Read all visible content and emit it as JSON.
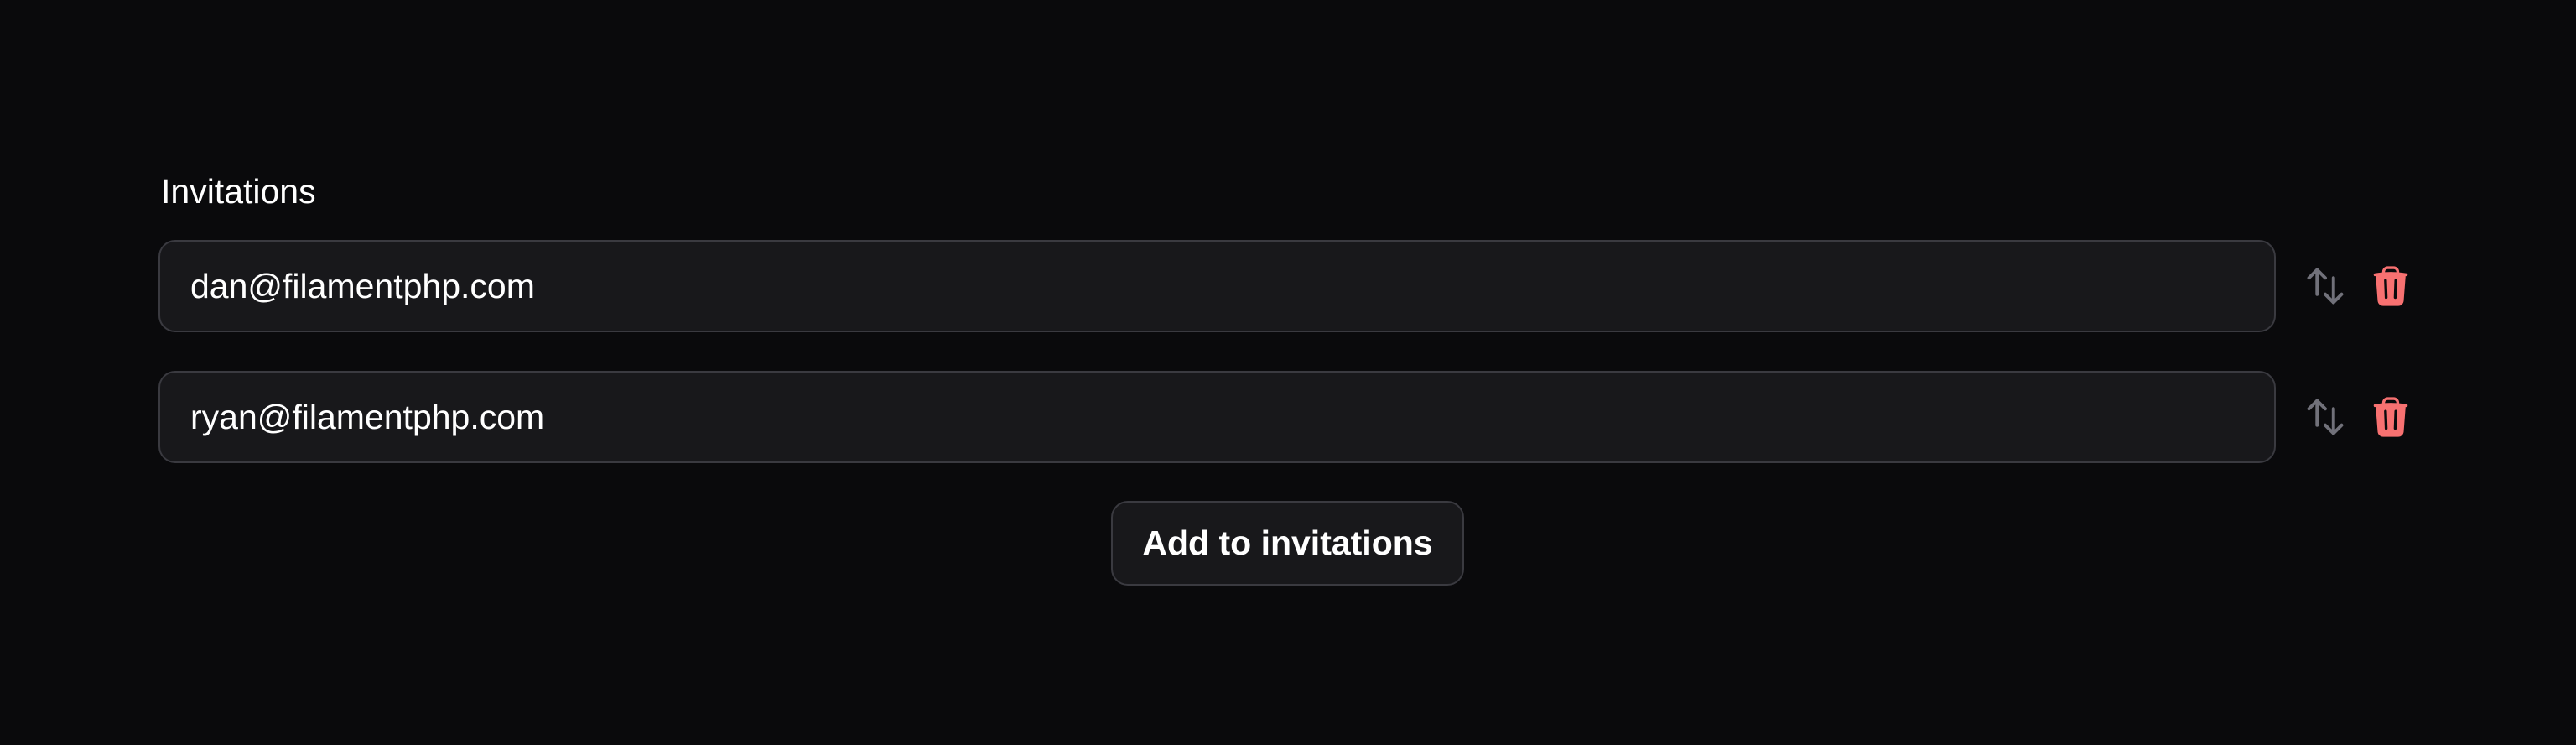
{
  "field": {
    "label": "Invitations"
  },
  "items": [
    {
      "email": "dan@filamentphp.com"
    },
    {
      "email": "ryan@filamentphp.com"
    }
  ],
  "actions": {
    "add_label": "Add to invitations",
    "reorder_icon": "arrows-up-down-icon",
    "delete_icon": "trash-icon"
  },
  "colors": {
    "background": "#0a0a0c",
    "input_background": "#18181b",
    "border": "#3a3a40",
    "danger": "#f87171",
    "muted_icon": "#71717a"
  }
}
